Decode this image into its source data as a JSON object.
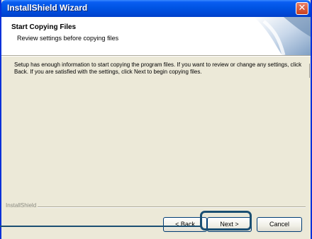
{
  "window": {
    "title": "InstallShield Wizard",
    "close_glyph": "✕"
  },
  "header": {
    "title": "Start Copying Files",
    "subtitle": "Review settings before copying files"
  },
  "body": {
    "message": "Setup has enough information to start copying the program files. If you want to review or change any settings, click Back. If you are satisfied with the settings, click Next to begin copying files."
  },
  "footer": {
    "brand": "InstallShield"
  },
  "buttons": {
    "back": "< Back",
    "next": "Next >",
    "cancel": "Cancel"
  },
  "colors": {
    "titlebar": "#0054e3",
    "highlight": "#1b4f72"
  }
}
